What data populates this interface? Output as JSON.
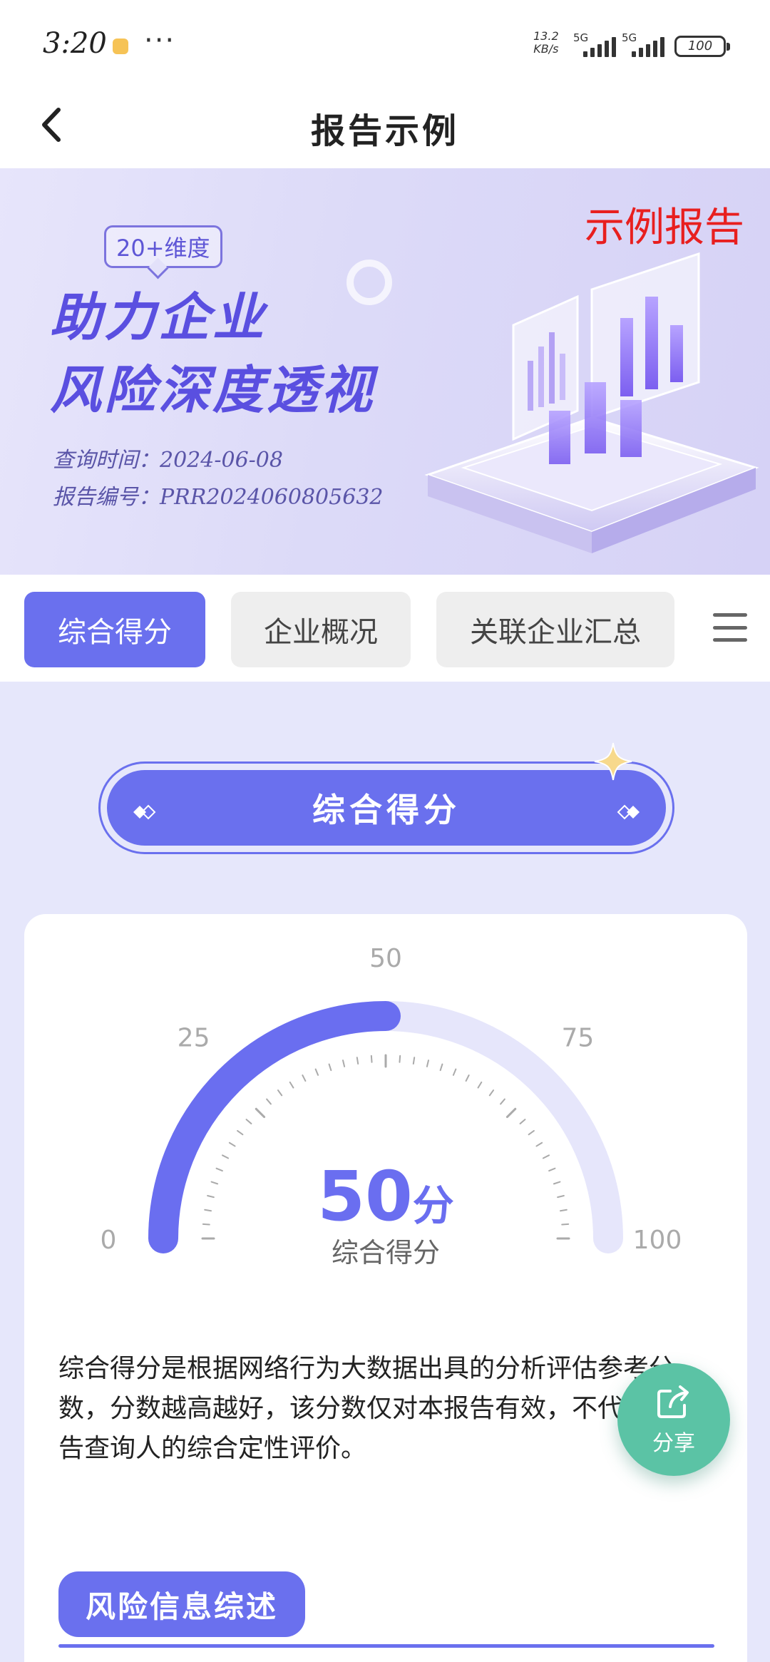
{
  "status_bar": {
    "time": "3:20",
    "more": "···",
    "net_speed_value": "13.2",
    "net_speed_unit": "KB/s",
    "sig1_label": "5G",
    "sig2_label": "5G",
    "battery": "100"
  },
  "nav": {
    "title": "报告示例"
  },
  "banner": {
    "badge": "20+维度",
    "headline_line1": "助力企业",
    "headline_line2": "风险深度透视",
    "query_time": "查询时间：2024-06-08",
    "report_no": "报告编号：PRR2024060805632",
    "sample_tag": "示例报告"
  },
  "tabs": [
    {
      "label": "综合得分",
      "active": true
    },
    {
      "label": "企业概况",
      "active": false
    },
    {
      "label": "关联企业汇总",
      "active": false
    }
  ],
  "section": {
    "title": "综合得分"
  },
  "gauge": {
    "min": 0,
    "max": 100,
    "value": 50,
    "tick_labels": [
      "0",
      "25",
      "50",
      "75",
      "100"
    ],
    "value_text": "50",
    "unit_text": "分",
    "label": "综合得分",
    "colors": {
      "fill": "#6a6ef0",
      "track": "#e6e6fb",
      "ticks": "#aaaaaa"
    }
  },
  "description": "综合得分是根据网络行为大数据出具的分析评估参考分数，分数越高越好，该分数仅对本报告有效，不代表对报告查询人的综合定性评价。",
  "risk_section": {
    "title": "风险信息综述"
  },
  "share": {
    "label": "分享"
  }
}
